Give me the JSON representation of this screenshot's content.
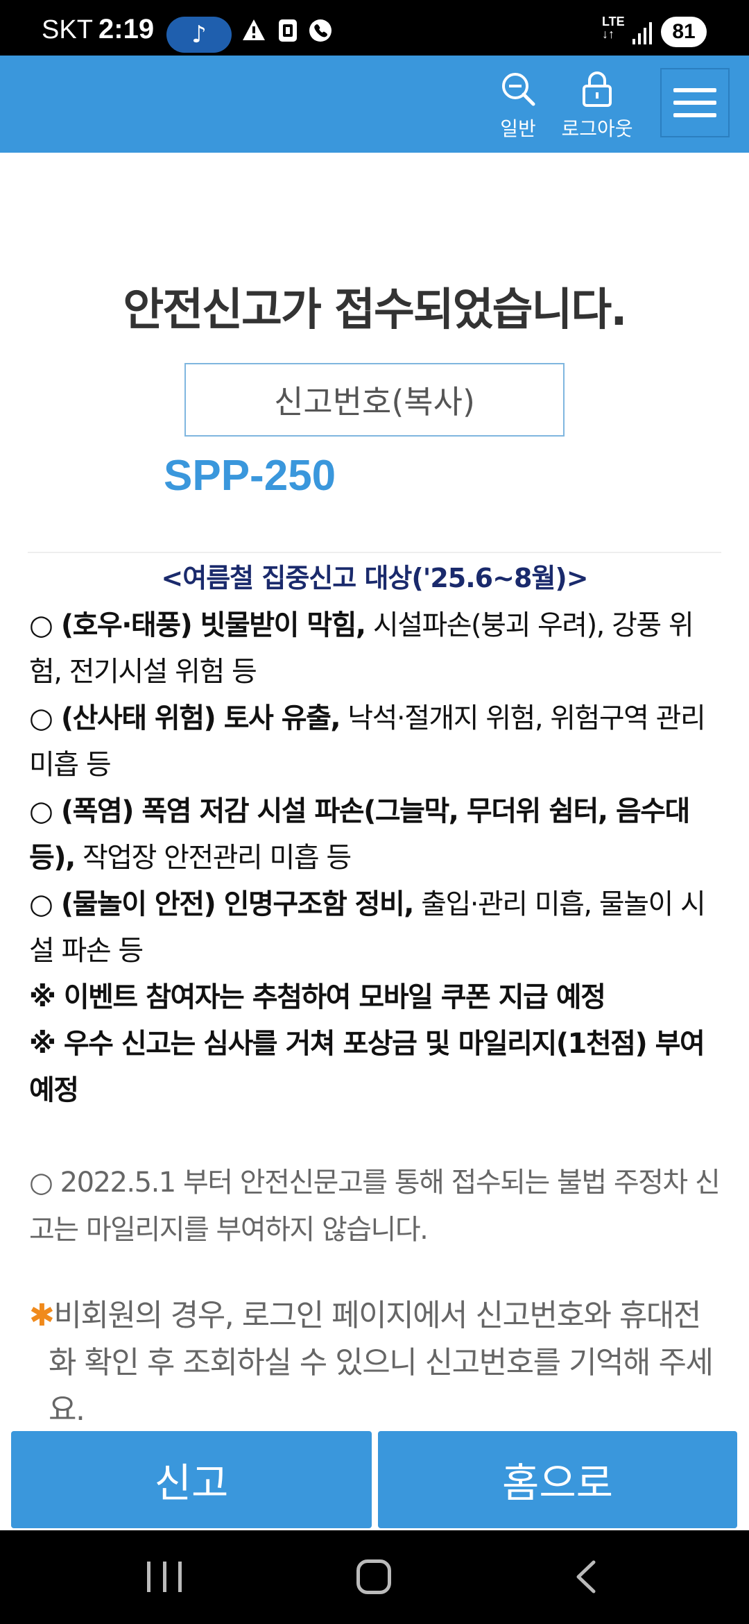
{
  "status_bar": {
    "carrier": "SKT",
    "time": "2:19",
    "music_glyph": "♪",
    "lte": "LTE",
    "battery": "81",
    "icons": [
      "music-note-icon",
      "warning-icon",
      "sim-icon",
      "call-icon",
      "lte-icon",
      "signal-icon",
      "battery-icon"
    ]
  },
  "header": {
    "general_label": "일반",
    "logout_label": "로그아웃",
    "accent_color": "#3a97dc"
  },
  "main": {
    "title": "안전신고가 접수되었습니다.",
    "copy_button_label": "신고번호(복사)",
    "report_number": "SPP-250"
  },
  "notice": {
    "title": "<여름철 집중신고 대상('25.6~8월)>",
    "items": [
      {
        "bold": "○ (호우·태풍) 빗물받이 막힘,",
        "normal": " 시설파손(붕괴 우려), 강풍 위험, 전기시설 위험 등"
      },
      {
        "bold": "○ (산사태 위험) 토사 유출,",
        "normal": " 낙석·절개지 위험, 위험구역 관리 미흡 등"
      },
      {
        "bold": "○ (폭염) 폭염 저감 시설 파손(그늘막, 무더위 쉼터, 음수대 등),",
        "normal": " 작업장 안전관리 미흡 등"
      },
      {
        "bold": "○ (물놀이 안전) 인명구조함 정비,",
        "normal": " 출입·관리 미흡, 물놀이 시설 파손 등"
      }
    ],
    "events": [
      "※ 이벤트 참여자는 추첨하여 모바일 쿠폰 지급 예정",
      "※ 우수 신고는 심사를 거쳐 포상금 및 마일리지(1천점) 부여 예정"
    ]
  },
  "gray_note": "○ 2022.5.1 부터 안전신문고를 통해 접수되는 불법 주정차 신고는 마일리지를 부여하지 않습니다.",
  "orange_note": {
    "star": "✱",
    "text": "비회원의 경우, 로그인 페이지에서 신고번호와 휴대전화 확인 후 조회하실 수 있으니 신고번호를 기억해 주세요."
  },
  "buttons": {
    "report": "신고",
    "home": "홈으로"
  }
}
